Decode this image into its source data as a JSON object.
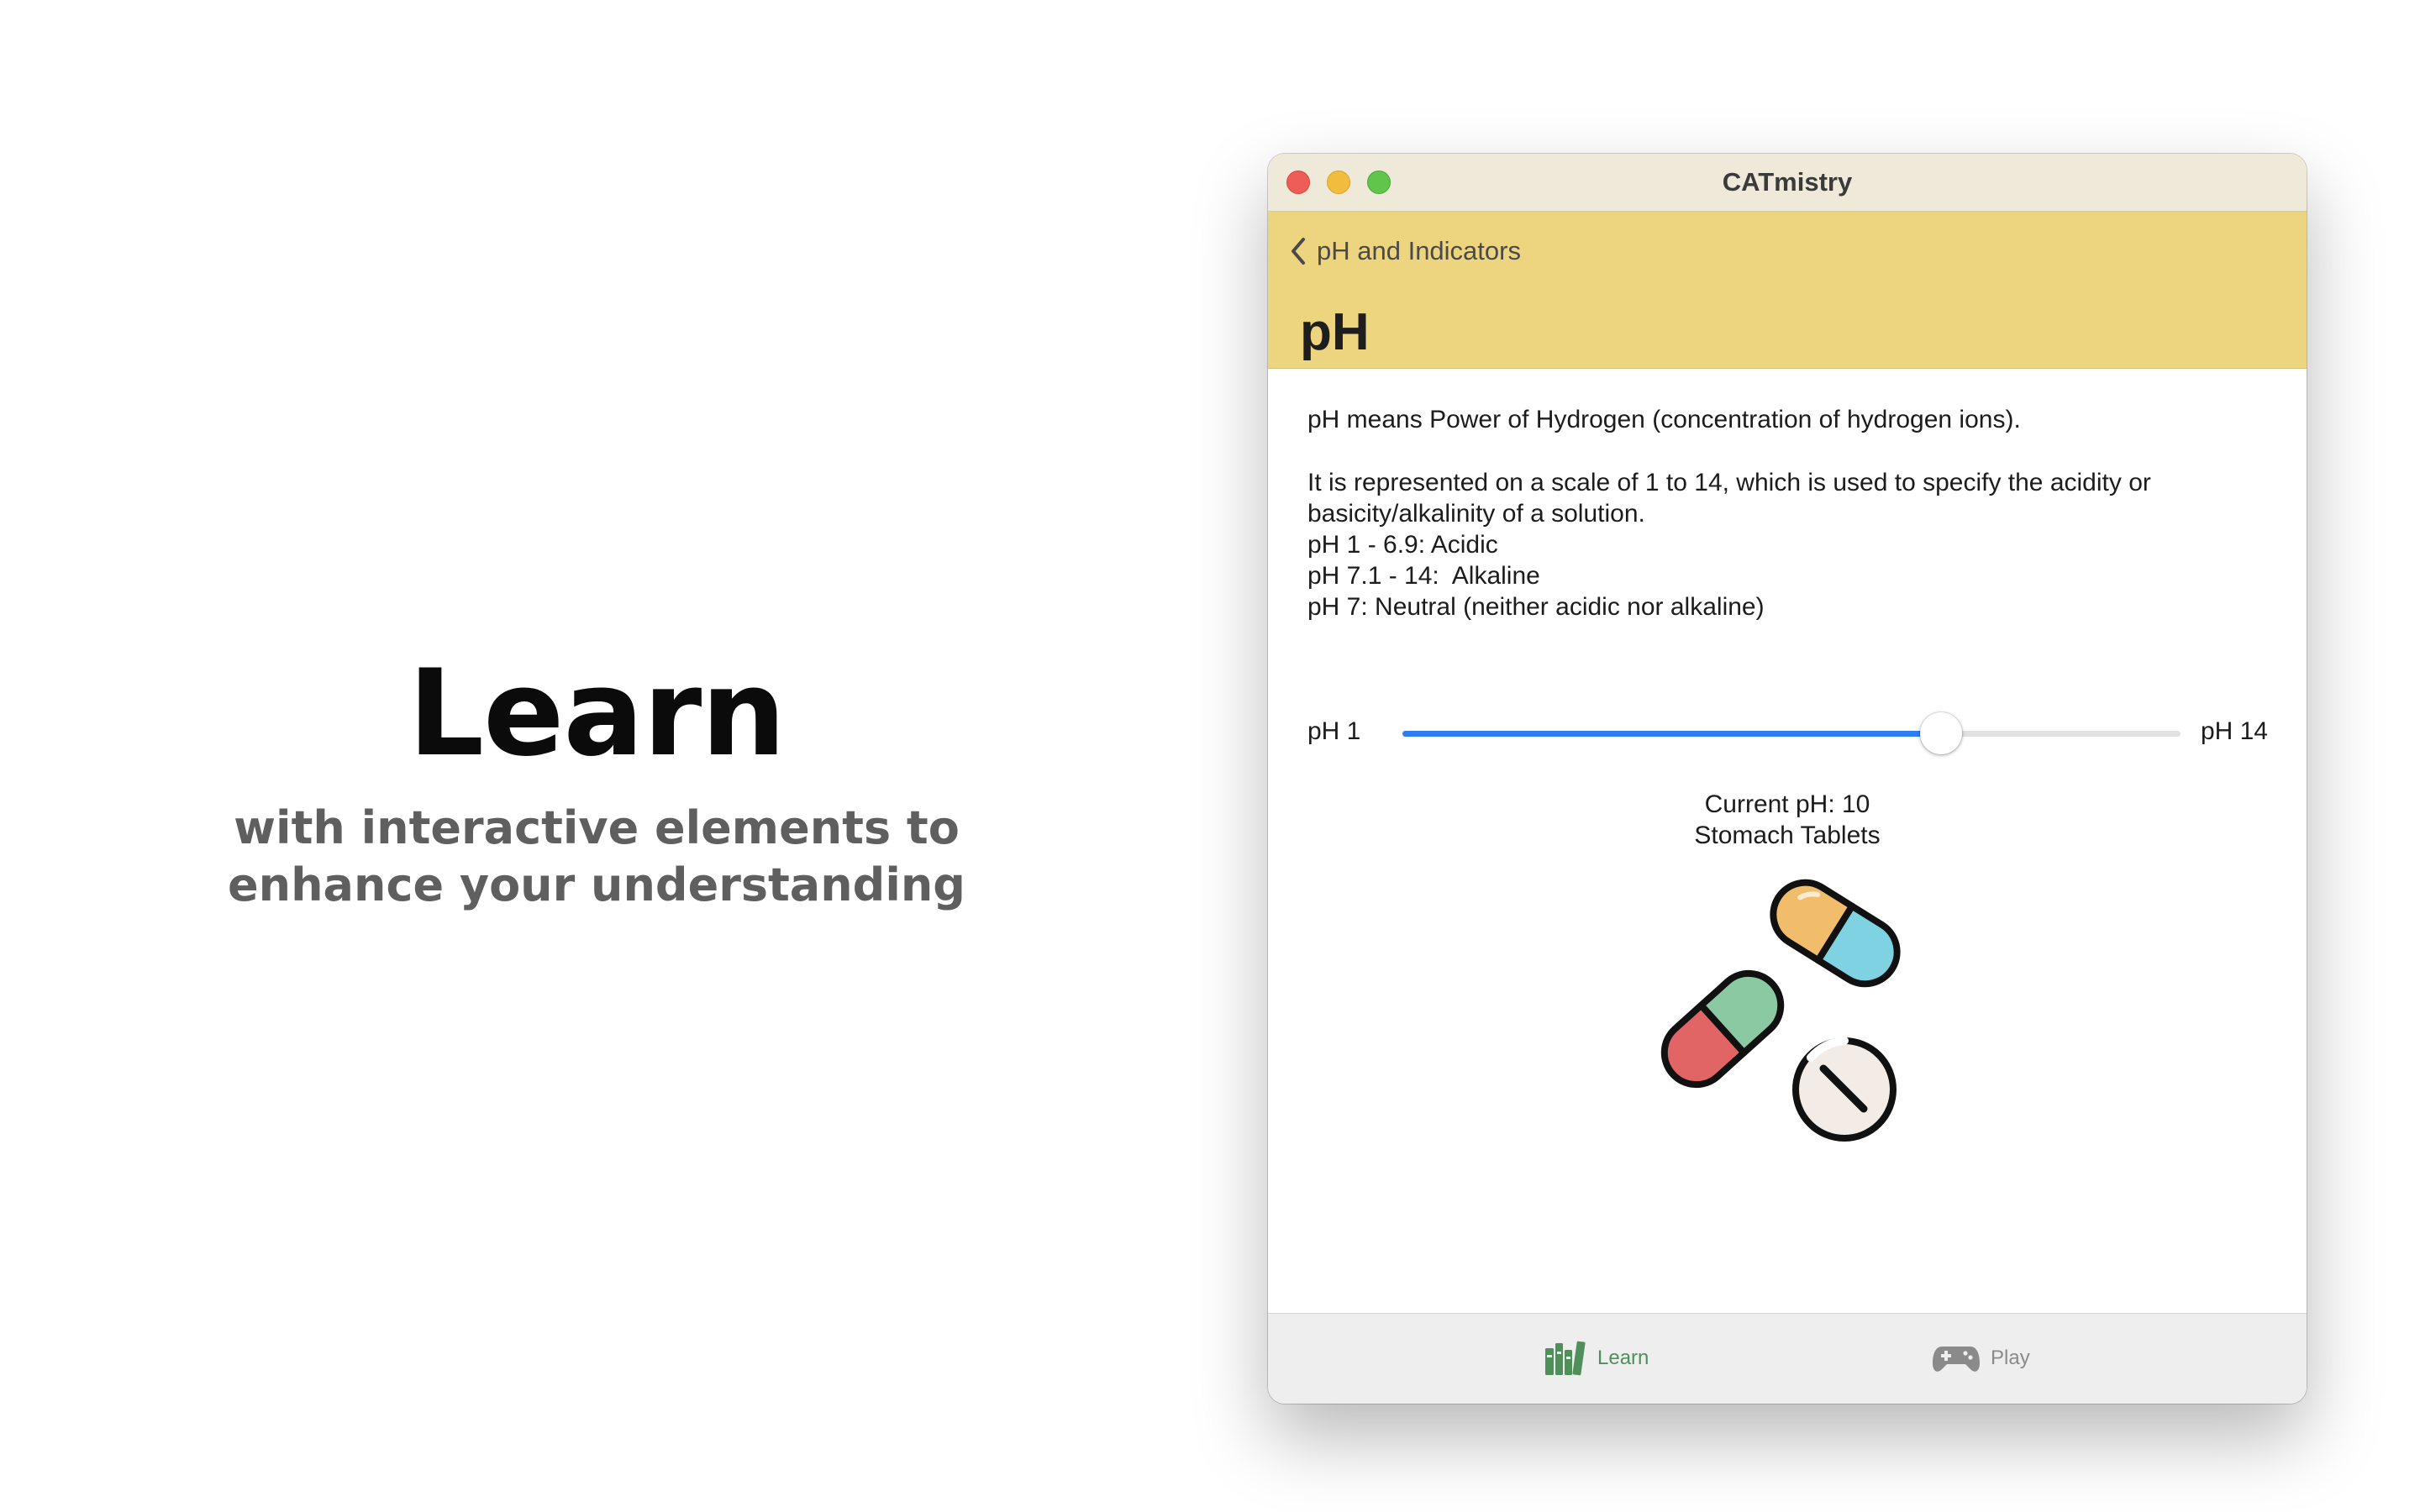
{
  "promo": {
    "title": "Learn",
    "subtitle_line1": "with interactive elements to",
    "subtitle_line2": "enhance your understanding"
  },
  "window": {
    "title": "CATmistry"
  },
  "navbar": {
    "back_label": "pH and Indicators",
    "title": "pH"
  },
  "content": {
    "paragraph1": "pH means Power of Hydrogen (concentration of hydrogen ions).",
    "paragraph2_line1": "It is represented on a scale of 1 to 14, which is used to specify the acidity or",
    "paragraph2_line2": "basicity/alkalinity of a solution.",
    "ranges": [
      "pH 1 - 6.9: Acidic",
      "pH 7.1 - 14:  Alkaline",
      "pH 7: Neutral (neither acidic nor alkaline)"
    ],
    "slider": {
      "min_label": "pH 1",
      "max_label": "pH 14",
      "min": 1,
      "max": 14,
      "value": 10
    },
    "current_ph": "Current pH: 10",
    "current_substance": "Stomach Tablets",
    "illustration_icon": "pills-icon"
  },
  "tabbar": {
    "tabs": [
      {
        "label": "Learn",
        "icon": "books-icon",
        "selected": true
      },
      {
        "label": "Play",
        "icon": "gamepad-icon",
        "selected": false
      }
    ]
  },
  "colors": {
    "navbar_bg": "#edd57f",
    "titlebar_bg": "#efe9da",
    "slider_accent": "#2f7df2",
    "tab_selected": "#4f8f5a"
  }
}
